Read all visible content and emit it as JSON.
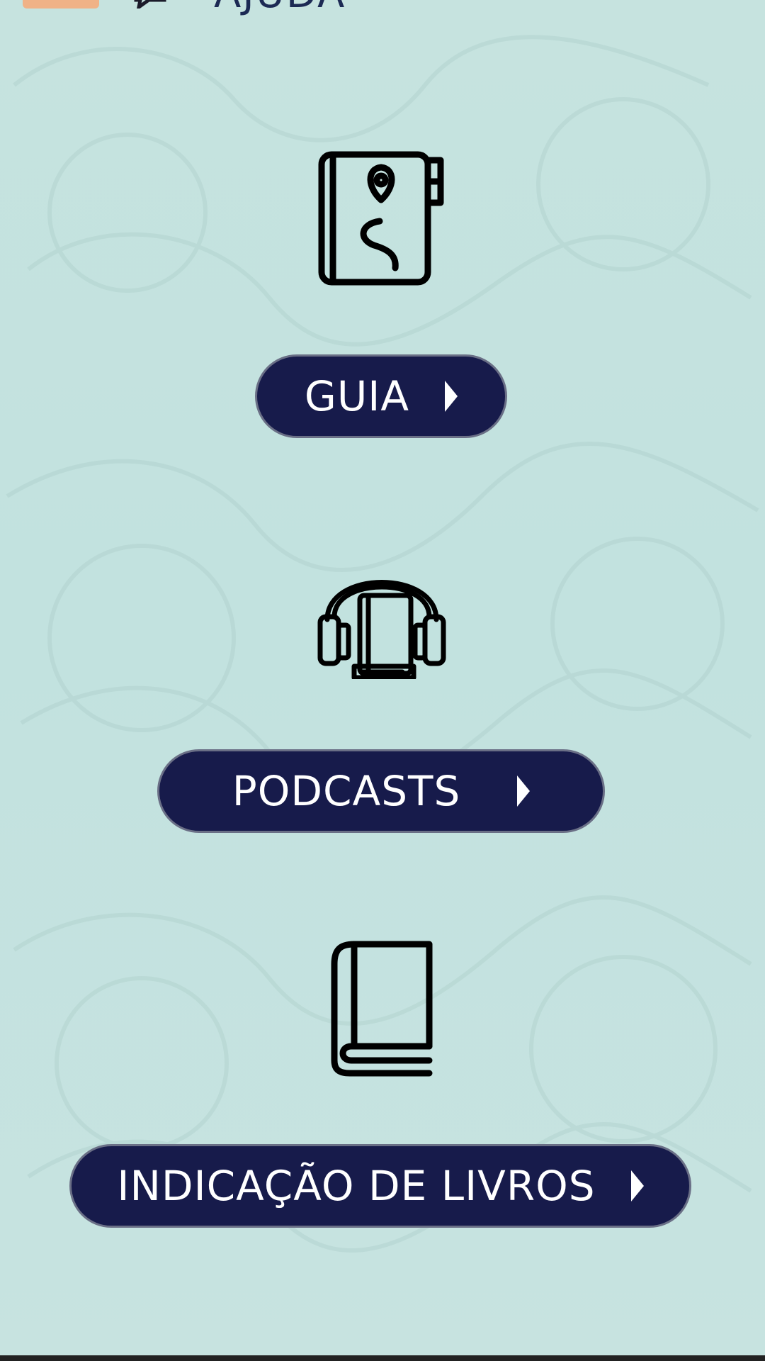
{
  "header": {
    "title": "AJUDA",
    "menu_icon": "menu-icon",
    "chat_icon": "chat-icon"
  },
  "items": [
    {
      "icon": "guide-book-map-icon",
      "label": "GUIA"
    },
    {
      "icon": "audiobook-headphones-icon",
      "label": "PODCASTS"
    },
    {
      "icon": "book-icon",
      "label": "INDICAÇÃO DE LIVROS"
    }
  ],
  "colors": {
    "background": "#c4e2df",
    "button": "#171b4b",
    "button_text": "#ffffff",
    "accent": "#f0b287"
  }
}
